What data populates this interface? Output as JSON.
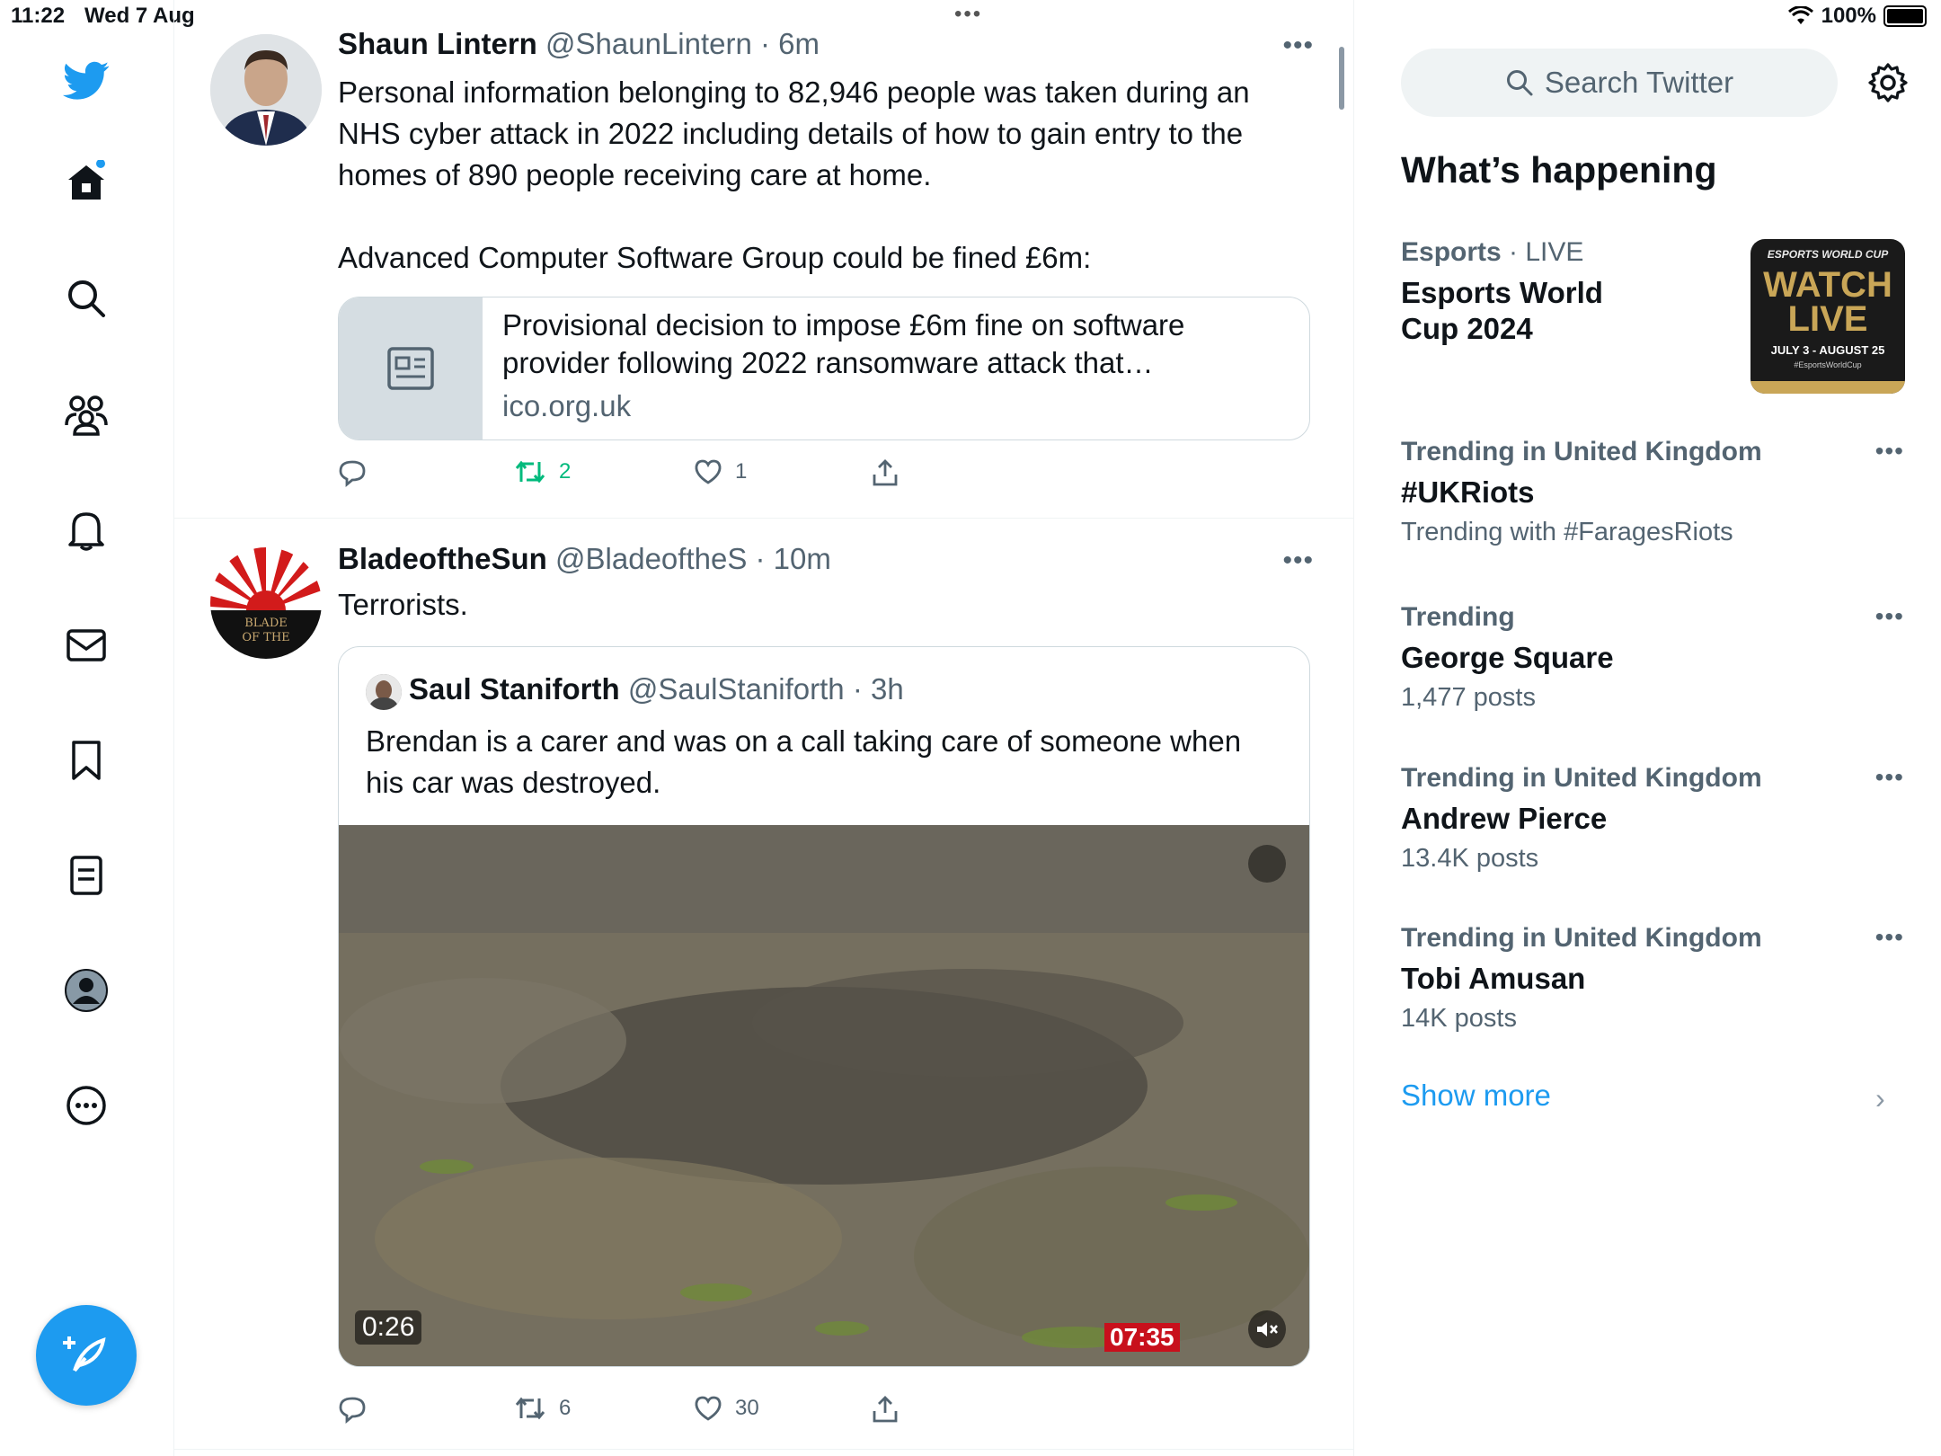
{
  "status_bar": {
    "time": "11:22",
    "date": "Wed 7 Aug",
    "battery": "100%"
  },
  "nav": {
    "items": [
      "home",
      "explore",
      "communities",
      "notifications",
      "messages",
      "bookmarks",
      "lists",
      "profile",
      "more"
    ]
  },
  "feed": {
    "tweets": [
      {
        "name": "Shaun Lintern",
        "handle": "@ShaunLintern",
        "time": "· 6m",
        "text1": "Personal information belonging to 82,946 people was taken during an NHS cyber attack in 2022 including details of how to gain entry to the homes of 890 people receiving care at home.",
        "text2": "Advanced Computer Software Group could be fined £6m:",
        "link_card": {
          "title": "Provisional decision to impose £6m fine on software provider following 2022 ransomware attack that…",
          "domain": "ico.org.uk"
        },
        "retweets": "2",
        "likes": "1"
      },
      {
        "name": "BladeoftheSun",
        "handle": "@BladeoftheS",
        "time": "· 10m",
        "text": "Terrorists.",
        "avatar_text": "BLADE OF THE SUN",
        "quote": {
          "name": "Saul Staniforth",
          "handle": "@SaulStaniforth",
          "time": "· 3h",
          "text": "Brendan is a carer and was on a call taking care of someone when his car was destroyed.",
          "video_duration": "0:26",
          "video_timestamp": "07:35"
        },
        "retweets": "6",
        "likes": "30"
      }
    ]
  },
  "sidebar": {
    "search_placeholder": "Search Twitter",
    "title": "What’s happening",
    "featured": {
      "category": "Esports",
      "live": "· LIVE",
      "name": "Esports World Cup 2024",
      "image_text": {
        "top": "ESPORTS WORLD CUP",
        "main1": "WATCH",
        "main2": "LIVE",
        "dates": "JULY 3 - AUGUST 25",
        "tag": "#EsportsWorldCup"
      }
    },
    "trends": [
      {
        "category": "Trending in United Kingdom",
        "name": "#UKRiots",
        "sub": "Trending with #FaragesRiots"
      },
      {
        "category": "Trending",
        "name": "George Square",
        "sub": "1,477 posts"
      },
      {
        "category": "Trending in United Kingdom",
        "name": "Andrew Pierce",
        "sub": "13.4K posts"
      },
      {
        "category": "Trending in United Kingdom",
        "name": "Tobi Amusan",
        "sub": "14K posts"
      }
    ],
    "show_more": "Show more"
  },
  "colors": {
    "accent": "#1d9bf0",
    "retweet": "#00ba7c",
    "muted": "#536471"
  }
}
